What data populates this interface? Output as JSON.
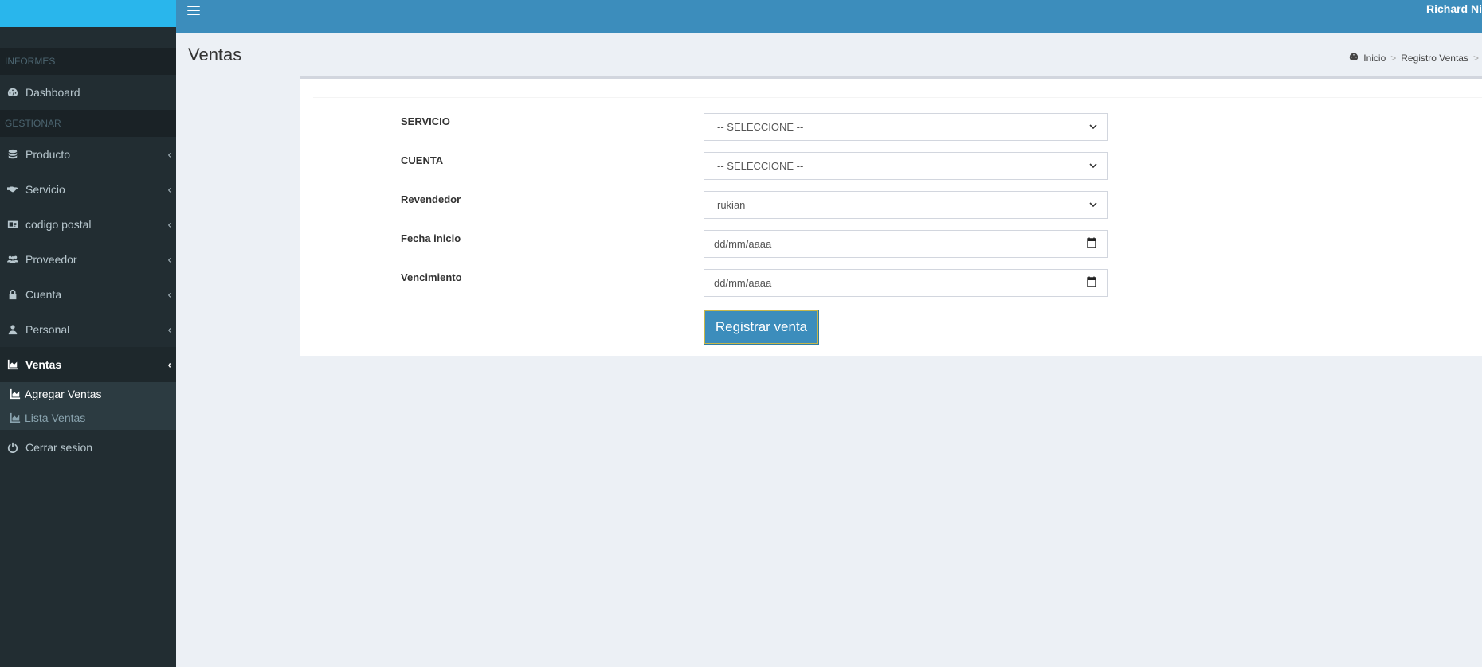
{
  "topbar": {
    "user_name": "Richard Ni"
  },
  "sidebar": {
    "header_reports": "INFORMES",
    "header_manage": "GESTIONAR",
    "items": [
      {
        "label": "Dashboard",
        "icon": "dashboard-icon"
      },
      {
        "label": "Producto",
        "icon": "database-icon"
      },
      {
        "label": "Servicio",
        "icon": "handshake-icon"
      },
      {
        "label": "codigo postal",
        "icon": "id-card-icon"
      },
      {
        "label": "Proveedor",
        "icon": "users-icon"
      },
      {
        "label": "Cuenta",
        "icon": "lock-icon"
      },
      {
        "label": "Personal",
        "icon": "user-icon"
      },
      {
        "label": "Ventas",
        "icon": "area-chart-icon"
      },
      {
        "label": "Cerrar sesion",
        "icon": "power-icon"
      }
    ],
    "ventas_sub": [
      {
        "label": "Agregar Ventas",
        "icon": "area-chart-icon"
      },
      {
        "label": "Lista Ventas",
        "icon": "area-chart-icon"
      }
    ]
  },
  "page": {
    "title": "Ventas",
    "breadcrumb": [
      "Inicio",
      "Registro Ventas"
    ]
  },
  "form": {
    "fields": [
      {
        "label": "SERVICIO",
        "value": "-- SELECCIONE --",
        "type": "select"
      },
      {
        "label": "CUENTA",
        "value": "-- SELECCIONE --",
        "type": "select"
      },
      {
        "label": "Revendedor",
        "value": "rukian",
        "type": "select"
      },
      {
        "label": "Fecha inicio",
        "value": "dd/mm/aaaa",
        "type": "date"
      },
      {
        "label": "Vencimiento",
        "value": "dd/mm/aaaa",
        "type": "date"
      }
    ],
    "submit_label": "Registrar venta"
  },
  "colors": {
    "topbar": "#3c8dbc",
    "logo": "#29b6ec",
    "sidebar": "#222d32"
  }
}
